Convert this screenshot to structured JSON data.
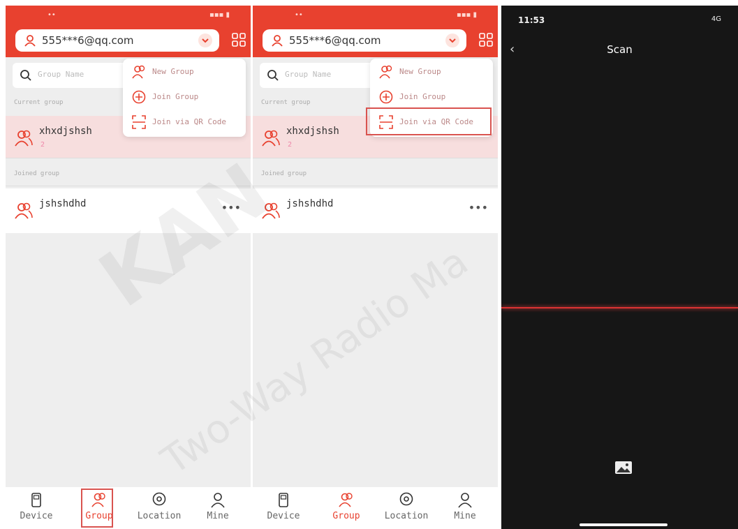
{
  "app": {
    "account_email": "555***6@qq.com",
    "search_placeholder": "Group Name",
    "section_current": "Current group",
    "section_joined": "Joined group",
    "current_group": {
      "name": "xhxdjshsh",
      "sub": "2"
    },
    "joined_group": {
      "name": "jshshdhd"
    },
    "more": "•••",
    "menu": [
      {
        "label": "New Group",
        "icon": "group-icon"
      },
      {
        "label": "Join Group",
        "icon": "plus-circle-icon"
      },
      {
        "label": "Join via QR Code",
        "icon": "qr-scan-icon"
      }
    ],
    "tabs": [
      {
        "label": "Device",
        "icon": "device-icon"
      },
      {
        "label": "Group",
        "icon": "group-icon"
      },
      {
        "label": "Location",
        "icon": "location-icon"
      },
      {
        "label": "Mine",
        "icon": "person-icon"
      }
    ]
  },
  "scan": {
    "time": "11:53",
    "network": "4G",
    "back": "‹",
    "title": "Scan",
    "gallery_icon": "image-icon"
  },
  "watermark": {
    "brand": "KAN",
    "subtitle": "Two-Way Radio Ma"
  },
  "colors": {
    "primary": "#e8412f",
    "highlight": "#d9534f",
    "scan_line": "#dd3333"
  }
}
